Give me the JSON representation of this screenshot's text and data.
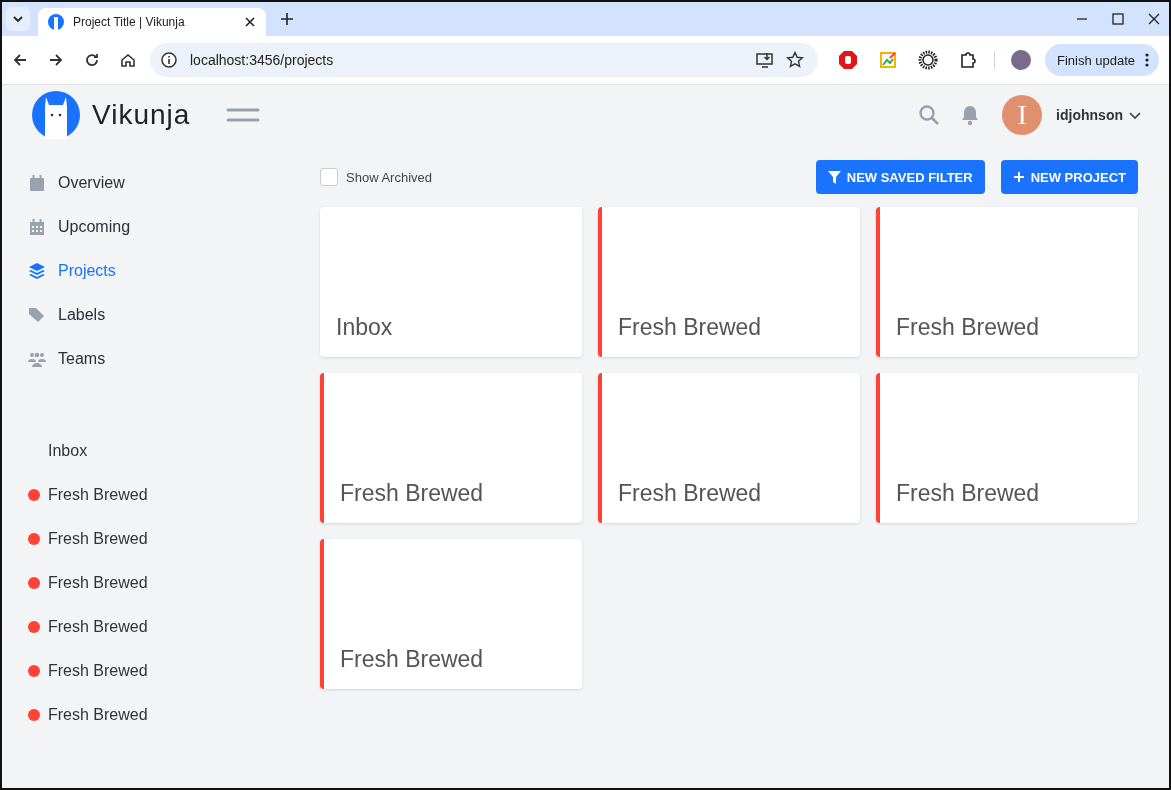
{
  "browser": {
    "tab_title": "Project Title | Vikunja",
    "url": "localhost:3456/projects",
    "update_button": "Finish update"
  },
  "header": {
    "brand": "Vikunja",
    "user_initial": "I",
    "user_name": "idjohnson"
  },
  "nav": [
    {
      "label": "Overview",
      "kind": "overview",
      "selected": false
    },
    {
      "label": "Upcoming",
      "kind": "upcoming",
      "selected": false
    },
    {
      "label": "Projects",
      "kind": "projects",
      "selected": true
    },
    {
      "label": "Labels",
      "kind": "labels",
      "selected": false
    },
    {
      "label": "Teams",
      "kind": "teams",
      "selected": false
    }
  ],
  "sidebar_projects": [
    {
      "title": "Inbox"
    },
    {
      "title": "Fresh Brewed",
      "color": "#ff4136"
    },
    {
      "title": "Fresh Brewed",
      "color": "#ff4136"
    },
    {
      "title": "Fresh Brewed",
      "color": "#ff4136"
    },
    {
      "title": "Fresh Brewed",
      "color": "#ff4136"
    },
    {
      "title": "Fresh Brewed",
      "color": "#ff4136"
    },
    {
      "title": "Fresh Brewed",
      "color": "#ff4136"
    }
  ],
  "show_archived": {
    "label": "Show Archived",
    "checked": false
  },
  "actions": [
    {
      "label": "NEW SAVED FILTER",
      "kind": "filter"
    },
    {
      "label": "NEW PROJECT",
      "kind": "create"
    }
  ],
  "projects": [
    {
      "title": "Inbox"
    },
    {
      "title": "Fresh Brewed",
      "color": "#ff4136"
    },
    {
      "title": "Fresh Brewed",
      "color": "#ff4136"
    },
    {
      "title": "Fresh Brewed",
      "color": "#ff4136"
    },
    {
      "title": "Fresh Brewed",
      "color": "#ff4136"
    },
    {
      "title": "Fresh Brewed",
      "color": "#ff4136"
    },
    {
      "title": "Fresh Brewed",
      "color": "#ff4136"
    }
  ]
}
